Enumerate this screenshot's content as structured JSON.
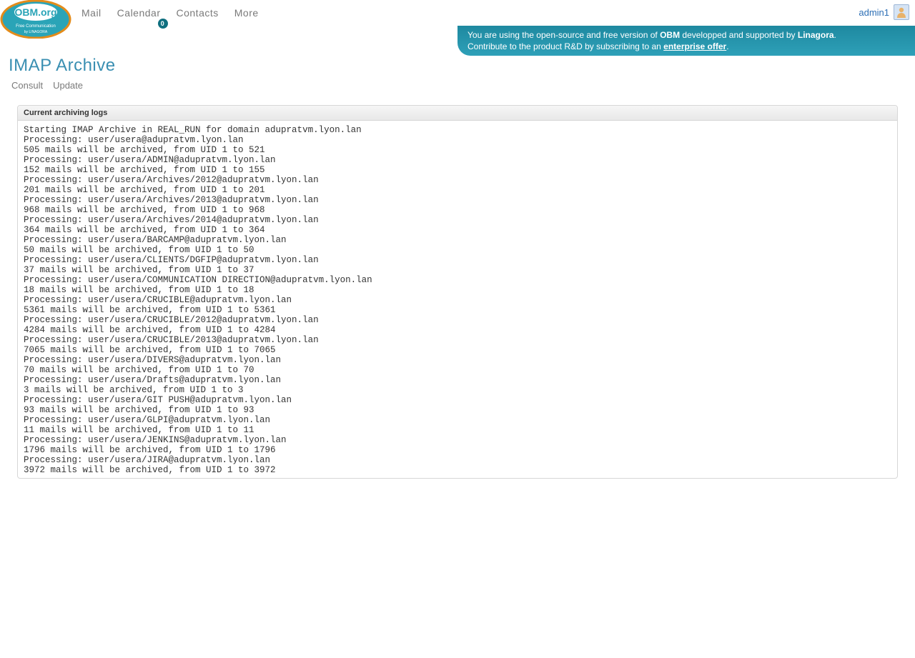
{
  "nav": {
    "items": [
      {
        "label": "Mail"
      },
      {
        "label": "Calendar",
        "badge": "0"
      },
      {
        "label": "Contacts"
      },
      {
        "label": "More"
      }
    ]
  },
  "user": {
    "name": "admin1"
  },
  "banner": {
    "line1_pre": "You are using the open-source and free version of ",
    "brand": "OBM",
    "line1_mid": " developped and supported by ",
    "company": "Linagora",
    "line1_post": ".",
    "line2_pre": "Contribute to the product R&D by subscribing to an ",
    "offer": "enterprise offer",
    "line2_post": "."
  },
  "page": {
    "title": "IMAP Archive",
    "tabs": [
      {
        "label": "Consult"
      },
      {
        "label": "Update"
      }
    ],
    "panel_header": "Current archiving logs"
  },
  "log": "Starting IMAP Archive in REAL_RUN for domain adupratvm.lyon.lan\nProcessing: user/usera@adupratvm.lyon.lan\n505 mails will be archived, from UID 1 to 521\nProcessing: user/usera/ADMIN@adupratvm.lyon.lan\n152 mails will be archived, from UID 1 to 155\nProcessing: user/usera/Archives/2012@adupratvm.lyon.lan\n201 mails will be archived, from UID 1 to 201\nProcessing: user/usera/Archives/2013@adupratvm.lyon.lan\n968 mails will be archived, from UID 1 to 968\nProcessing: user/usera/Archives/2014@adupratvm.lyon.lan\n364 mails will be archived, from UID 1 to 364\nProcessing: user/usera/BARCAMP@adupratvm.lyon.lan\n50 mails will be archived, from UID 1 to 50\nProcessing: user/usera/CLIENTS/DGFIP@adupratvm.lyon.lan\n37 mails will be archived, from UID 1 to 37\nProcessing: user/usera/COMMUNICATION DIRECTION@adupratvm.lyon.lan\n18 mails will be archived, from UID 1 to 18\nProcessing: user/usera/CRUCIBLE@adupratvm.lyon.lan\n5361 mails will be archived, from UID 1 to 5361\nProcessing: user/usera/CRUCIBLE/2012@adupratvm.lyon.lan\n4284 mails will be archived, from UID 1 to 4284\nProcessing: user/usera/CRUCIBLE/2013@adupratvm.lyon.lan\n7065 mails will be archived, from UID 1 to 7065\nProcessing: user/usera/DIVERS@adupratvm.lyon.lan\n70 mails will be archived, from UID 1 to 70\nProcessing: user/usera/Drafts@adupratvm.lyon.lan\n3 mails will be archived, from UID 1 to 3\nProcessing: user/usera/GIT PUSH@adupratvm.lyon.lan\n93 mails will be archived, from UID 1 to 93\nProcessing: user/usera/GLPI@adupratvm.lyon.lan\n11 mails will be archived, from UID 1 to 11\nProcessing: user/usera/JENKINS@adupratvm.lyon.lan\n1796 mails will be archived, from UID 1 to 1796\nProcessing: user/usera/JIRA@adupratvm.lyon.lan\n3972 mails will be archived, from UID 1 to 3972\n"
}
